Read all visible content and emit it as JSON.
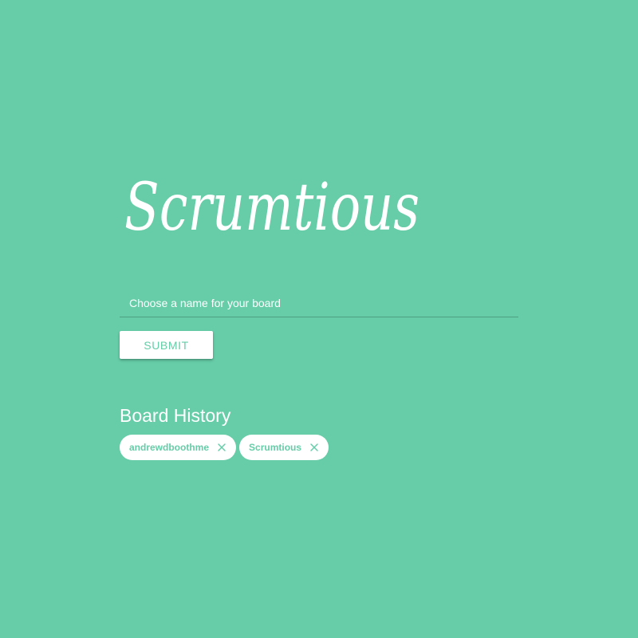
{
  "app": {
    "logo_text": "Scrumtious",
    "accent_color": "#66cda8"
  },
  "form": {
    "name_placeholder": "Choose a name for your board",
    "name_value": "",
    "submit_label": "SUBMIT"
  },
  "history": {
    "title": "Board History",
    "boards": [
      {
        "label": "andrewdboothme",
        "remove_icon": "close-icon"
      },
      {
        "label": "Scrumtious",
        "remove_icon": "close-icon"
      }
    ]
  }
}
